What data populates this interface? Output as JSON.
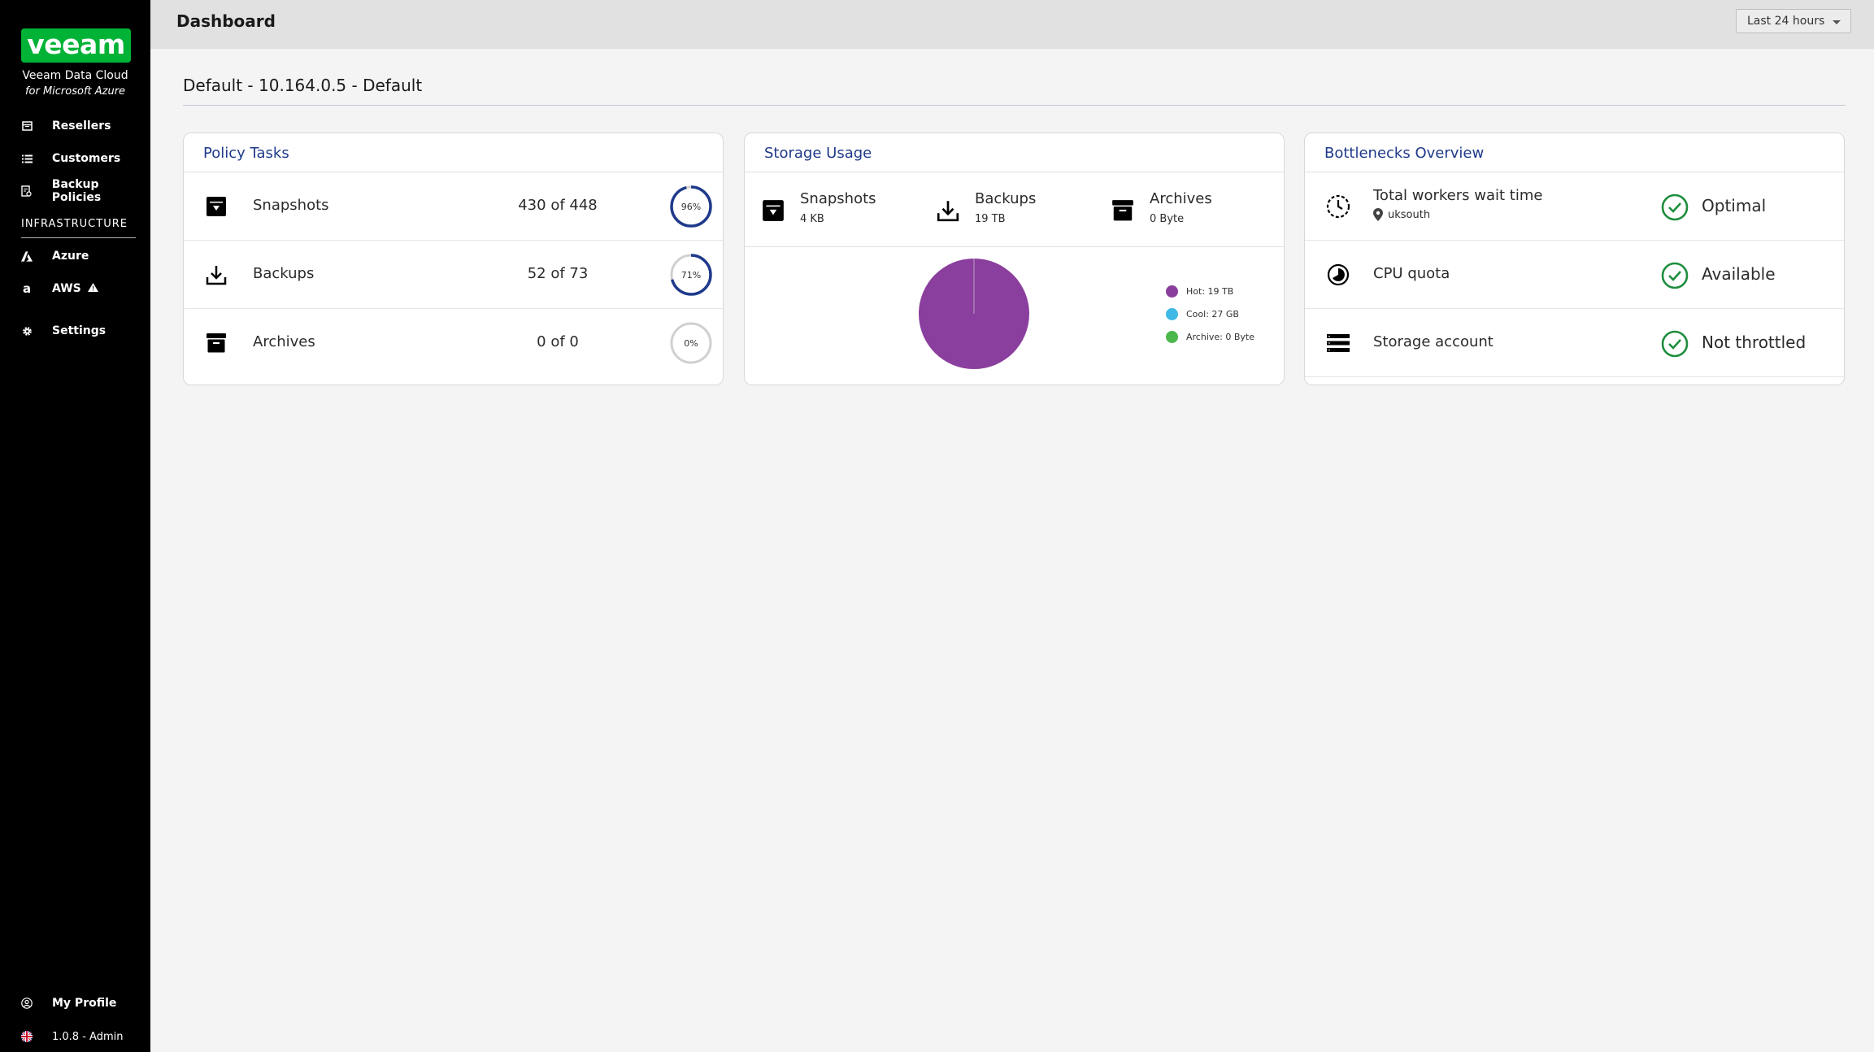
{
  "sidebar": {
    "logo": "veeam",
    "brand_line1": "Veeam Data Cloud",
    "brand_line2": "for Microsoft Azure",
    "items": [
      {
        "label": "Resellers",
        "icon": "resellers-icon"
      },
      {
        "label": "Customers",
        "icon": "list-icon"
      },
      {
        "label": "Backup Policies",
        "icon": "policy-icon"
      }
    ],
    "section_label": "INFRASTRUCTURE",
    "infra_items": [
      {
        "label": "Azure",
        "icon": "azure-icon"
      },
      {
        "label": "AWS",
        "icon": "amazon-icon"
      }
    ],
    "settings_label": "Settings",
    "profile_label": "My Profile",
    "version_label": "1.0.8 - Admin"
  },
  "header": {
    "title": "Dashboard",
    "time_range": "Last 24 hours"
  },
  "server_title": "Default - 10.164.0.5 - Default",
  "policy_tasks": {
    "title": "Policy Tasks",
    "rows": [
      {
        "name": "Snapshots",
        "count": "430 of 448",
        "percent_label": "96%",
        "percent": 96
      },
      {
        "name": "Backups",
        "count": "52 of 73",
        "percent_label": "71%",
        "percent": 71
      },
      {
        "name": "Archives",
        "count": "0 of 0",
        "percent_label": "0%",
        "percent": 0
      }
    ]
  },
  "storage_usage": {
    "title": "Storage Usage",
    "items": [
      {
        "name": "Snapshots",
        "value": "4 KB"
      },
      {
        "name": "Backups",
        "value": "19 TB"
      },
      {
        "name": "Archives",
        "value": "0 Byte"
      }
    ],
    "legend": [
      {
        "label": "Hot: 19 TB",
        "color": "#8a3e9d"
      },
      {
        "label": "Cool: 27 GB",
        "color": "#3fb8e6"
      },
      {
        "label": "Archive: 0 Byte",
        "color": "#4cb84c"
      }
    ]
  },
  "bottlenecks": {
    "title": "Bottlenecks Overview",
    "rows": [
      {
        "name": "Total workers wait time",
        "sub": "uksouth",
        "status": "Optimal",
        "icon": "clock-icon"
      },
      {
        "name": "CPU quota",
        "status": "Available",
        "icon": "cpu-gauge-icon"
      },
      {
        "name": "Storage account",
        "status": "Not throttled",
        "icon": "storage-icon"
      }
    ]
  },
  "colors": {
    "accent": "#1f3a8a",
    "brand_green": "#00b336",
    "status_green": "#1e8e3e"
  }
}
